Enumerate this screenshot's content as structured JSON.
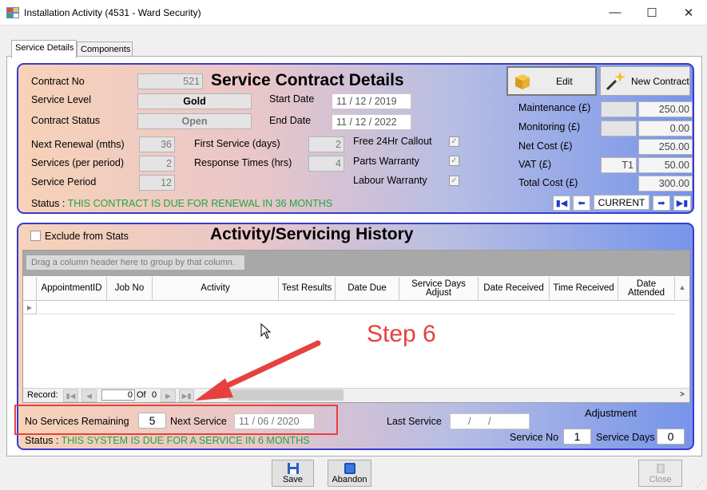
{
  "window": {
    "title": "Installation Activity (4531 - Ward Security)",
    "minimize": "—",
    "maximize": "☐",
    "close": "✕"
  },
  "tabs": [
    {
      "label": "Service Details"
    },
    {
      "label": "Components"
    }
  ],
  "contract": {
    "title": "Service Contract Details",
    "contract_no_label": "Contract No",
    "contract_no": "521",
    "service_level_label": "Service Level",
    "service_level": "Gold",
    "contract_status_label": "Contract Status",
    "contract_status": "Open",
    "start_date_label": "Start Date",
    "start_date": "11 / 12 / 2019",
    "end_date_label": "End Date",
    "end_date": "11 / 12 / 2022",
    "next_renewal_label": "Next Renewal (mths)",
    "next_renewal": "36",
    "services_per_period_label": "Services (per period)",
    "services_per_period": "2",
    "service_period_label": "Service Period",
    "service_period": "12",
    "first_service_label": "First Service (days)",
    "first_service": "2",
    "response_times_label": "Response Times (hrs)",
    "response_times": "4",
    "free_callout_label": "Free 24Hr Callout",
    "parts_warranty_label": "Parts Warranty",
    "labour_warranty_label": "Labour Warranty",
    "status_prefix": "Status :",
    "status_text": "THIS CONTRACT IS DUE FOR RENEWAL IN 36 MONTHS",
    "edit_label": "Edit",
    "new_contract_label": "New Contract",
    "maintenance_label": "Maintenance (£)",
    "maintenance": "250.00",
    "monitoring_label": "Monitoring (£)",
    "monitoring": "0.00",
    "net_cost_label": "Net Cost (£)",
    "net_cost": "250.00",
    "vat_label": "VAT (£)",
    "vat_code": "T1",
    "vat": "50.00",
    "total_cost_label": "Total Cost (£)",
    "total_cost": "300.00",
    "current_label": "CURRENT"
  },
  "history": {
    "exclude_label": "Exclude from Stats",
    "title": "Activity/Servicing History",
    "group_hint": "Drag a column header here to group by that column.",
    "columns": [
      "AppointmentID",
      "Job No",
      "Activity",
      "Test Results",
      "Date Due",
      "Service Days Adjust",
      "Date Received",
      "Time Received",
      "Date Attended"
    ],
    "record_label": "Record:",
    "record_value": "0",
    "of_label": "Of",
    "of_value": "0",
    "annotation": "Step 6",
    "no_services_label": "No Services Remaining",
    "no_services": "5",
    "next_service_label": "Next Service",
    "next_service": "11 / 06 / 2020",
    "last_service_label": "Last Service",
    "last_service": "/ /",
    "adjustment_label": "Adjustment",
    "service_no_label": "Service No",
    "service_no": "1",
    "service_days_label": "Service Days",
    "service_days": "0",
    "status_prefix": "Status :",
    "status_text": "THIS SYSTEM IS DUE FOR A SERVICE IN 6 MONTHS"
  },
  "footer": {
    "save": "Save",
    "abandon": "Abandon",
    "close": "Close"
  },
  "colors": {
    "panel_border": "#3a3ad0",
    "status_green": "#22a63a",
    "annotation_red": "#e5413f"
  }
}
